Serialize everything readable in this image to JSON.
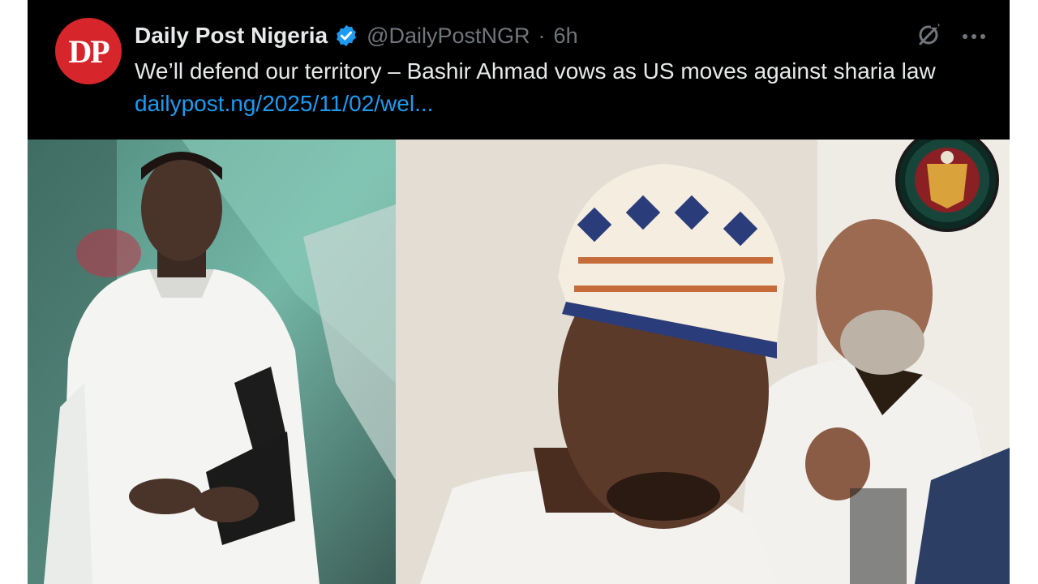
{
  "tweet": {
    "author_name": "Daily Post Nigeria",
    "avatar_text": "DP",
    "handle": "@DailyPostNGR",
    "separator": "·",
    "time_ago": "6h",
    "text": "We’ll defend our territory – Bashir Ahmad vows as US moves against sharia law ",
    "link_text": "dailypost.ng/2025/11/02/wel..."
  },
  "icons": {
    "verified": "verified-badge-icon",
    "grok": "grok-icon",
    "more": "more-options-icon"
  },
  "colors": {
    "background": "#000000",
    "text": "#e7e9ea",
    "secondary_text": "#71767b",
    "link": "#1d9bf0",
    "verified": "#1d9bf0",
    "avatar_bg": "#d7262b"
  }
}
